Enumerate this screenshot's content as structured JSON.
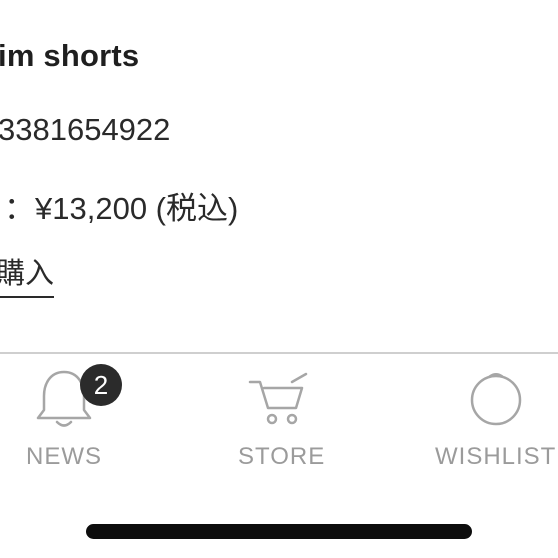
{
  "product": {
    "title": "im shorts",
    "code": "3381654922",
    "price": "：¥13,200 (税込)",
    "buy_link_label": "購入"
  },
  "tabbar": {
    "tabs": [
      {
        "label": "NEWS",
        "icon": "bell-icon",
        "badge": "2"
      },
      {
        "label": "STORE",
        "icon": "cart-icon"
      },
      {
        "label": "WISHLIST",
        "icon": "circle-icon"
      }
    ]
  },
  "colors": {
    "text": "#1f1f1f",
    "tab_inactive": "#9b9b9b",
    "badge_bg": "#2b2b2b",
    "divider": "#cfcfcf",
    "home_indicator": "#0d0d0d"
  }
}
